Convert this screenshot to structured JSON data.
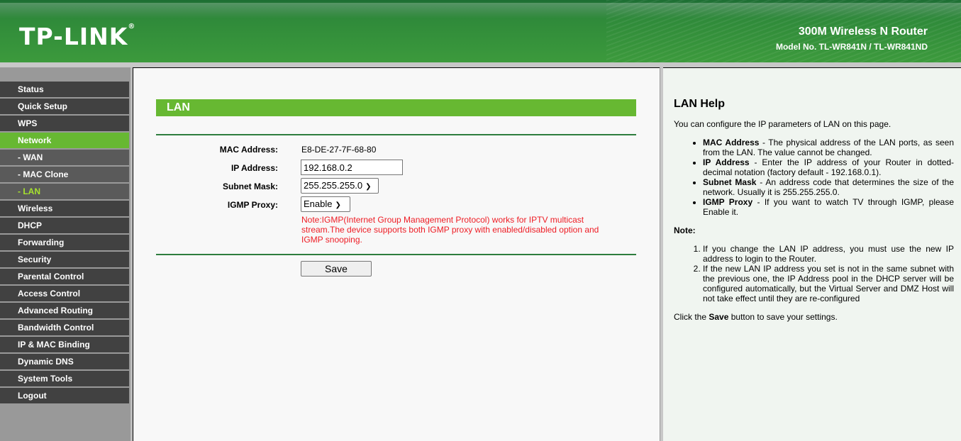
{
  "header": {
    "logo": "TP-LINK",
    "product": "300M Wireless N Router",
    "model": "Model No. TL-WR841N / TL-WR841ND"
  },
  "sidebar": {
    "items": [
      {
        "label": "Status",
        "type": "top"
      },
      {
        "label": "Quick Setup",
        "type": "top"
      },
      {
        "label": "WPS",
        "type": "top"
      },
      {
        "label": "Network",
        "type": "active"
      },
      {
        "label": "- WAN",
        "type": "sub"
      },
      {
        "label": "- MAC Clone",
        "type": "sub"
      },
      {
        "label": "- LAN",
        "type": "cur"
      },
      {
        "label": "Wireless",
        "type": "top"
      },
      {
        "label": "DHCP",
        "type": "top"
      },
      {
        "label": "Forwarding",
        "type": "top"
      },
      {
        "label": "Security",
        "type": "top"
      },
      {
        "label": "Parental Control",
        "type": "top"
      },
      {
        "label": "Access Control",
        "type": "top"
      },
      {
        "label": "Advanced Routing",
        "type": "top"
      },
      {
        "label": "Bandwidth Control",
        "type": "top"
      },
      {
        "label": "IP & MAC Binding",
        "type": "top"
      },
      {
        "label": "Dynamic DNS",
        "type": "top"
      },
      {
        "label": "System Tools",
        "type": "top"
      },
      {
        "label": "Logout",
        "type": "top"
      }
    ]
  },
  "main": {
    "title": "LAN",
    "mac_label": "MAC Address:",
    "mac_value": "E8-DE-27-7F-68-80",
    "ip_label": "IP Address:",
    "ip_value": "192.168.0.2",
    "mask_label": "Subnet Mask:",
    "mask_value": "255.255.255.0",
    "igmp_label": "IGMP Proxy:",
    "igmp_value": "Enable",
    "note": "Note:IGMP(Internet Group Management Protocol) works for IPTV multicast stream.The device supports both IGMP proxy with enabled/disabled option and IGMP snooping.",
    "save": "Save"
  },
  "help": {
    "title": "LAN Help",
    "intro": "You can configure the IP parameters of LAN on this page.",
    "items": [
      {
        "term": "MAC Address",
        "desc": " - The physical address of the LAN ports, as seen from the LAN. The value cannot be changed."
      },
      {
        "term": "IP Address",
        "desc": " - Enter the IP address of your Router in dotted-decimal notation (factory default - 192.168.0.1)."
      },
      {
        "term": "Subnet Mask",
        "desc": " - An address code that determines the size of the network. Usually it is 255.255.255.0."
      },
      {
        "term": "IGMP Proxy",
        "desc": " - If you want to watch TV through IGMP, please Enable it."
      }
    ],
    "note_title": "Note:",
    "notes": [
      "If you change the LAN IP address, you must use the new IP address to login to the Router.",
      "If the new LAN IP address you set is not in the same subnet with the previous one, the IP Address pool in the DHCP server will be configured automatically, but the Virtual Server and DMZ Host will not take effect until they are re-configured"
    ],
    "last_pre": "Click the ",
    "last_bold": "Save",
    "last_post": " button to save your settings."
  },
  "colors": {
    "accent": "#67b832",
    "header": "#2f8a3a",
    "note": "#ee1c24"
  }
}
